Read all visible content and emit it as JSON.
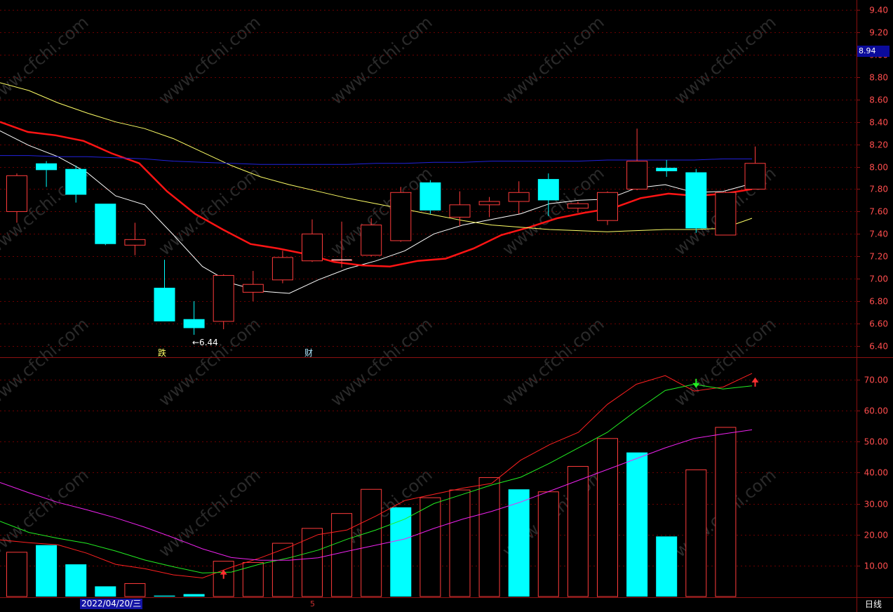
{
  "chart_data": [
    {
      "type": "candlestick",
      "panel": "price",
      "ylim": [
        6.3,
        9.45
      ],
      "y_ticks": [
        "9.40",
        "9.20",
        "9.00",
        "8.80",
        "8.60",
        "8.40",
        "8.20",
        "8.00",
        "7.80",
        "7.60",
        "7.40",
        "7.20",
        "7.00",
        "6.80",
        "6.60",
        "6.40"
      ],
      "current_price": "8.94",
      "low_label": "←6.44",
      "colors": {
        "up": "#ff3b3b",
        "down": "#00ffff",
        "grid": "#6a0000",
        "axis": "#8b1010",
        "tick_text": "#ff4d4d"
      },
      "candles": [
        {
          "o": 7.6,
          "h": 7.94,
          "l": 7.5,
          "c": 7.92
        },
        {
          "o": 8.03,
          "h": 8.05,
          "l": 7.82,
          "c": 7.97
        },
        {
          "o": 7.98,
          "h": 8.01,
          "l": 7.68,
          "c": 7.75
        },
        {
          "o": 7.67,
          "h": 7.67,
          "l": 7.3,
          "c": 7.31
        },
        {
          "o": 7.3,
          "h": 7.5,
          "l": 7.21,
          "c": 7.35
        },
        {
          "o": 6.92,
          "h": 7.17,
          "l": 6.62,
          "c": 6.62
        },
        {
          "o": 6.64,
          "h": 6.8,
          "l": 6.5,
          "c": 6.56
        },
        {
          "o": 6.62,
          "h": 7.04,
          "l": 6.55,
          "c": 7.03
        },
        {
          "o": 6.88,
          "h": 7.07,
          "l": 6.8,
          "c": 6.95
        },
        {
          "o": 6.99,
          "h": 7.25,
          "l": 6.96,
          "c": 7.19
        },
        {
          "o": 7.16,
          "h": 7.53,
          "l": 7.15,
          "c": 7.4
        },
        {
          "o": 7.17,
          "h": 7.51,
          "l": 7.1,
          "c": 7.17
        },
        {
          "o": 7.21,
          "h": 7.54,
          "l": 7.2,
          "c": 7.48
        },
        {
          "o": 7.34,
          "h": 7.82,
          "l": 7.33,
          "c": 7.77
        },
        {
          "o": 7.86,
          "h": 7.88,
          "l": 7.58,
          "c": 7.61
        },
        {
          "o": 7.55,
          "h": 7.78,
          "l": 7.47,
          "c": 7.66
        },
        {
          "o": 7.66,
          "h": 7.73,
          "l": 7.55,
          "c": 7.69
        },
        {
          "o": 7.69,
          "h": 7.87,
          "l": 7.58,
          "c": 7.77
        },
        {
          "o": 7.89,
          "h": 7.94,
          "l": 7.56,
          "c": 7.7
        },
        {
          "o": 7.63,
          "h": 7.69,
          "l": 7.59,
          "c": 7.67
        },
        {
          "o": 7.52,
          "h": 7.78,
          "l": 7.48,
          "c": 7.77
        },
        {
          "o": 7.8,
          "h": 8.34,
          "l": 7.79,
          "c": 8.05
        },
        {
          "o": 7.99,
          "h": 8.06,
          "l": 7.91,
          "c": 7.96
        },
        {
          "o": 7.95,
          "h": 7.98,
          "l": 7.41,
          "c": 7.45
        },
        {
          "o": 7.39,
          "h": 7.78,
          "l": 7.39,
          "c": 7.77
        },
        {
          "o": 7.8,
          "h": 8.18,
          "l": 7.8,
          "c": 8.03
        }
      ],
      "ma_lines": [
        {
          "color": "#ffffff",
          "width": 1,
          "values": [
            8.32,
            8.19,
            8.09,
            7.95,
            7.74,
            7.66,
            7.39,
            7.11,
            6.96,
            6.89,
            6.87,
            6.99,
            7.09,
            7.16,
            7.25,
            7.4,
            7.48,
            7.53,
            7.58,
            7.67,
            7.7,
            7.71,
            7.81,
            7.84,
            7.77,
            7.78,
            7.85
          ]
        },
        {
          "color": "#ff1414",
          "width": 2.5,
          "values": [
            8.4,
            8.31,
            8.28,
            8.23,
            8.12,
            8.03,
            7.78,
            7.58,
            7.44,
            7.31,
            7.27,
            7.22,
            7.15,
            7.12,
            7.11,
            7.16,
            7.18,
            7.27,
            7.39,
            7.46,
            7.54,
            7.59,
            7.63,
            7.72,
            7.76,
            7.74,
            7.76,
            7.8
          ]
        },
        {
          "color": "#ffff66",
          "width": 1,
          "values": [
            8.75,
            8.68,
            8.57,
            8.48,
            8.4,
            8.34,
            8.25,
            8.13,
            8.01,
            7.91,
            7.84,
            7.78,
            7.72,
            7.67,
            7.62,
            7.57,
            7.52,
            7.48,
            7.46,
            7.44,
            7.43,
            7.42,
            7.43,
            7.44,
            7.44,
            7.45,
            7.54
          ]
        },
        {
          "color": "#2222dd",
          "width": 1,
          "values": [
            8.1,
            8.1,
            8.09,
            8.09,
            8.08,
            8.07,
            8.05,
            8.04,
            8.03,
            8.02,
            8.02,
            8.02,
            8.02,
            8.03,
            8.03,
            8.04,
            8.04,
            8.05,
            8.05,
            8.05,
            8.05,
            8.06,
            8.06,
            8.06,
            8.06,
            8.07,
            8.07
          ]
        }
      ],
      "signal_labels": {
        "die": "跌",
        "cai": "财"
      }
    },
    {
      "type": "bar",
      "panel": "indicator",
      "ylim": [
        0,
        77
      ],
      "y_ticks": [
        "70.00",
        "60.00",
        "50.00",
        "40.00",
        "30.00",
        "20.00",
        "10.00"
      ],
      "bars": [
        14.3,
        16.6,
        10.4,
        3.3,
        4.2,
        0.3,
        0.8,
        11.4,
        11.0,
        17.2,
        22.0,
        26.8,
        34.6,
        28.8,
        31.9,
        34.4,
        38.4,
        34.6,
        33.8,
        42.0,
        51.0,
        46.5,
        19.4,
        40.9,
        54.6
      ],
      "bar_up": [
        true,
        false,
        false,
        false,
        true,
        false,
        false,
        true,
        true,
        true,
        true,
        true,
        true,
        false,
        true,
        true,
        true,
        false,
        true,
        true,
        true,
        false,
        false,
        true,
        true
      ],
      "lines": [
        {
          "color": "#ff2020",
          "values": [
            18.3,
            17.4,
            16.7,
            14.0,
            10.4,
            9.0,
            7.0,
            6.0,
            9.5,
            12.5,
            16.0,
            20.0,
            21.5,
            26.0,
            31.0,
            33.0,
            35.0,
            36.5,
            44.0,
            49.0,
            53.0,
            62.0,
            68.5,
            71.3,
            66.3,
            67.6,
            72.0
          ]
        },
        {
          "color": "#22ee22",
          "values": [
            24.3,
            20.7,
            18.8,
            17.2,
            14.7,
            11.8,
            9.6,
            7.6,
            7.9,
            10.5,
            12.5,
            15.0,
            18.5,
            21.5,
            25.0,
            30.0,
            33.0,
            36.0,
            38.5,
            43.0,
            48.0,
            53.0,
            60.0,
            66.5,
            68.5,
            67.0,
            68.0
          ]
        },
        {
          "color": "#ee22ee",
          "values": [
            36.8,
            33.5,
            30.4,
            28.0,
            25.4,
            22.4,
            19.0,
            15.4,
            12.6,
            11.7,
            11.7,
            12.5,
            14.6,
            16.6,
            18.6,
            22.0,
            25.0,
            27.5,
            30.5,
            34.0,
            37.5,
            41.0,
            44.5,
            48.0,
            51.0,
            52.5,
            53.8
          ]
        }
      ],
      "arrows": [
        {
          "index": 7,
          "value": 8.0,
          "dir": "up",
          "color": "#ff3030"
        },
        {
          "index": 23,
          "value": 68.0,
          "dir": "down",
          "color": "#22ee22"
        },
        {
          "index": 25,
          "value": 70.0,
          "dir": "up",
          "color": "#ff3030"
        }
      ]
    }
  ],
  "x_axis": {
    "date_label": "2022/04/20/三",
    "mid_label": "5",
    "period": "日线"
  },
  "watermark": "www.cfchi.com"
}
